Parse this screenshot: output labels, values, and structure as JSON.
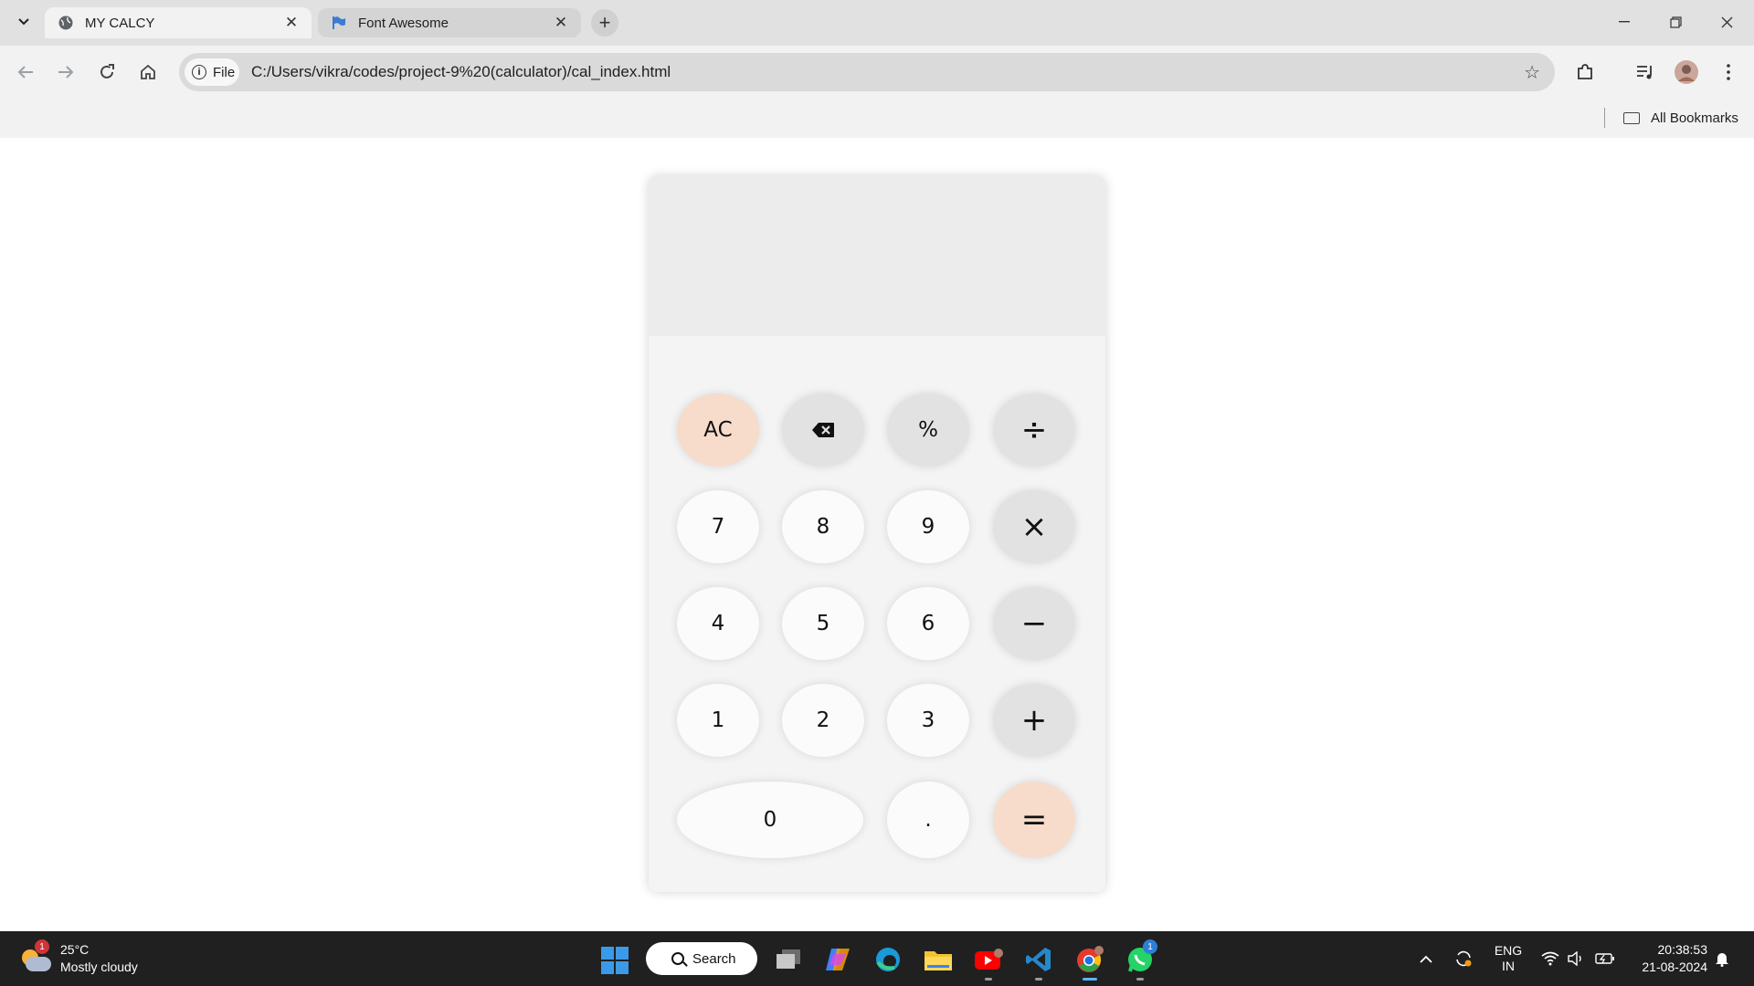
{
  "browser": {
    "tabs": [
      {
        "title": "MY CALCY",
        "active": true,
        "icon": "globe-icon"
      },
      {
        "title": "Font Awesome",
        "active": false,
        "icon": "flag-icon"
      }
    ],
    "address": {
      "chip_label": "File",
      "url": "C:/Users/vikra/codes/project-9%20(calculator)/cal_index.html"
    },
    "bookmarks_bar": {
      "all_bookmarks_label": "All Bookmarks"
    }
  },
  "calculator": {
    "display_value": "",
    "keys": [
      {
        "label": "AC",
        "kind": "warm"
      },
      {
        "label": "",
        "kind": "op",
        "icon": "backspace-icon"
      },
      {
        "label": "%",
        "kind": "op"
      },
      {
        "label": "÷",
        "kind": "op"
      },
      {
        "label": "7",
        "kind": "num"
      },
      {
        "label": "8",
        "kind": "num"
      },
      {
        "label": "9",
        "kind": "num"
      },
      {
        "label": "×",
        "kind": "op"
      },
      {
        "label": "4",
        "kind": "num"
      },
      {
        "label": "5",
        "kind": "num"
      },
      {
        "label": "6",
        "kind": "num"
      },
      {
        "label": "−",
        "kind": "op"
      },
      {
        "label": "1",
        "kind": "num"
      },
      {
        "label": "2",
        "kind": "num"
      },
      {
        "label": "3",
        "kind": "num"
      },
      {
        "label": "+",
        "kind": "op"
      },
      {
        "label": "0",
        "kind": "num"
      },
      {
        "label": ".",
        "kind": "num"
      },
      {
        "label": "=",
        "kind": "warm"
      }
    ]
  },
  "taskbar": {
    "weather": {
      "temperature": "25°C",
      "condition": "Mostly cloudy",
      "badge": "1"
    },
    "search_label": "Search",
    "apps": [
      {
        "name": "task-view"
      },
      {
        "name": "copilot"
      },
      {
        "name": "edge"
      },
      {
        "name": "file-explorer"
      },
      {
        "name": "youtube"
      },
      {
        "name": "vs-code"
      },
      {
        "name": "chrome"
      },
      {
        "name": "whatsapp",
        "badge": "1"
      }
    ],
    "tray": {
      "language": "ENG",
      "region": "IN"
    },
    "clock": {
      "time": "20:38:53",
      "date": "21-08-2024"
    }
  },
  "colors": {
    "warm_key": "#f7dccb",
    "op_key": "#e2e2e2",
    "num_key": "#fbfbfb",
    "taskbar": "#202020",
    "windows_blue": "#3b9ae8"
  }
}
